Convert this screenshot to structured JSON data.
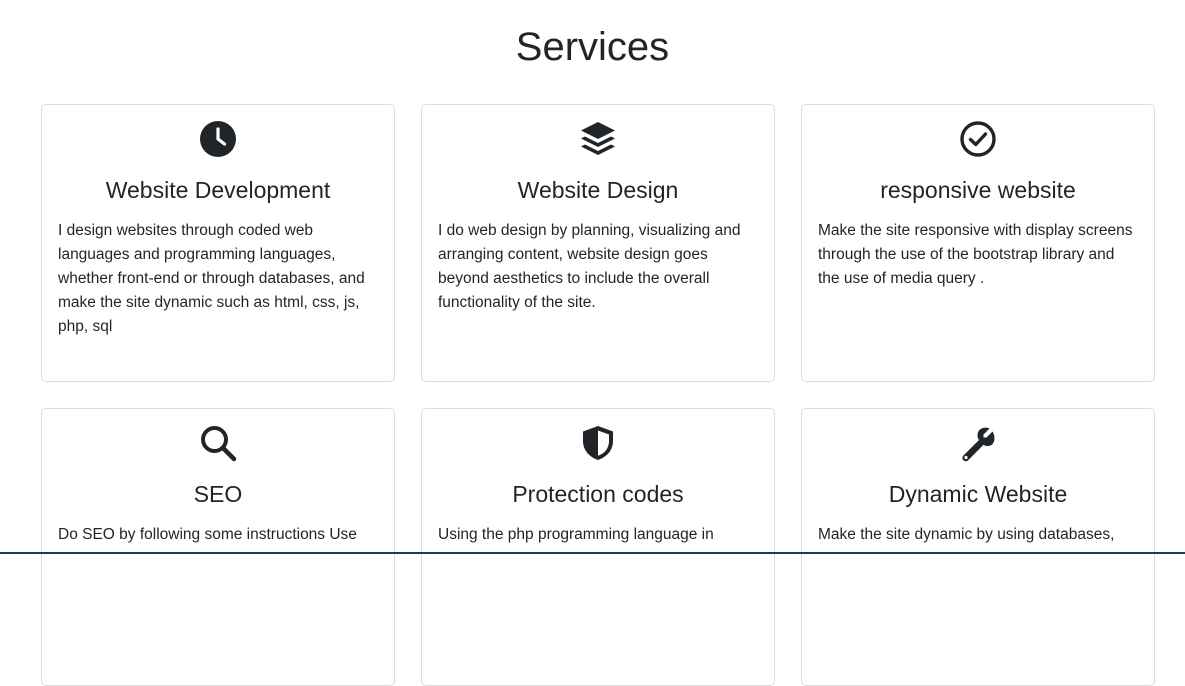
{
  "section": {
    "title": "Services"
  },
  "cards": [
    {
      "icon": "clock-icon",
      "title": "Website Development",
      "text": "I design websites through coded web languages and programming languages, whether front-end or through databases, and make the site dynamic such as html, css, js, php, sql"
    },
    {
      "icon": "layers-icon",
      "title": "Website Design",
      "text": "I do web design by planning, visualizing and arranging content, website design goes beyond aesthetics to include the overall functionality of the site."
    },
    {
      "icon": "check-circle-icon",
      "title": "responsive website",
      "text": "Make the site responsive with display screens through the use of the bootstrap library and the use of media query ."
    },
    {
      "icon": "search-icon",
      "title": "SEO",
      "text": "Do SEO by following some instructions Use"
    },
    {
      "icon": "shield-icon",
      "title": "Protection codes",
      "text": "Using the php programming language in"
    },
    {
      "icon": "wrench-icon",
      "title": "Dynamic Website",
      "text": "Make the site dynamic by using databases,"
    }
  ]
}
